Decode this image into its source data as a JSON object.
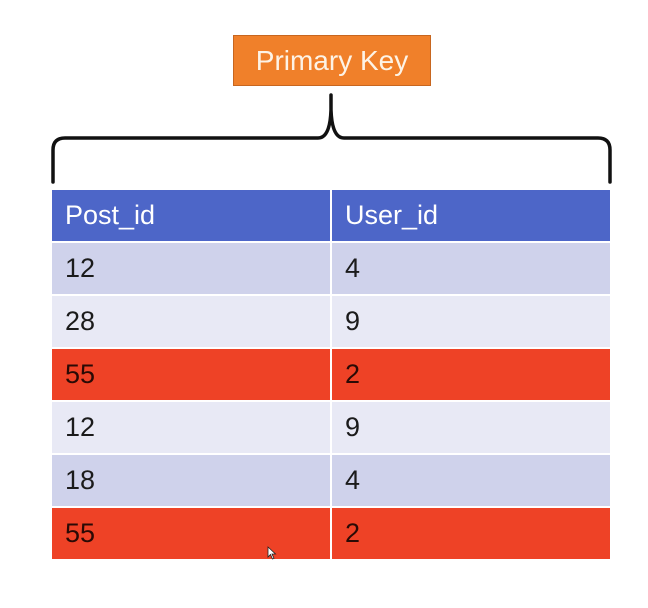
{
  "label": {
    "text": "Primary Key",
    "color": "#f0802a"
  },
  "table": {
    "headers": [
      "Post_id",
      "User_id"
    ],
    "header_color": "#4d66c8",
    "rows": [
      {
        "cells": [
          "12",
          "4"
        ],
        "style": "dark"
      },
      {
        "cells": [
          "28",
          "9"
        ],
        "style": "light"
      },
      {
        "cells": [
          "55",
          "2"
        ],
        "style": "red"
      },
      {
        "cells": [
          "12",
          "9"
        ],
        "style": "light"
      },
      {
        "cells": [
          "18",
          "4"
        ],
        "style": "dark"
      },
      {
        "cells": [
          "55",
          "2"
        ],
        "style": "red"
      }
    ],
    "highlight_color": "#ee4226"
  }
}
